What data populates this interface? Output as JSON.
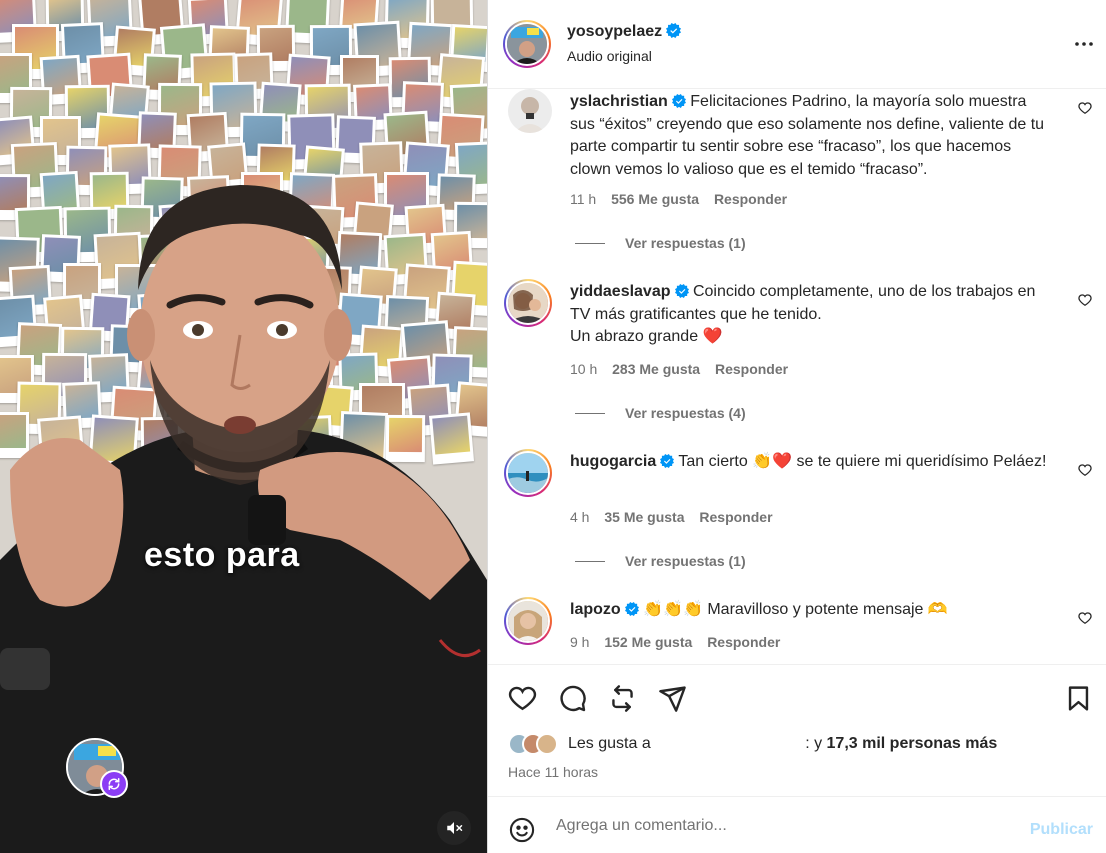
{
  "video": {
    "caption": "esto para",
    "mute_icon": "muted-speaker-icon",
    "remix_icon": "remix-icon"
  },
  "header": {
    "username": "yosoypelaez",
    "subtitle": "Audio original",
    "more_icon": "more-horizontal-icon"
  },
  "comments": [
    {
      "username": "yslachristian",
      "text": "Felicitaciones Padrino, la mayoría solo muestra sus “éxitos” creyendo que eso solamente nos define, valiente de tu parte compartir tu sentir sobre ese “fracaso”, los que hacemos clown vemos lo valioso que es el temido “fracaso”.",
      "time": "11 h",
      "likes": "556 Me gusta",
      "reply": "Responder",
      "view_replies": "Ver respuestas (1)"
    },
    {
      "username": "yiddaeslavap",
      "text": "Coincido completamente, uno de los trabajos en TV más gratificantes que he tenido.",
      "text2": "Un abrazo grande ❤️",
      "time": "10 h",
      "likes": "283 Me gusta",
      "reply": "Responder",
      "view_replies": "Ver respuestas (4)"
    },
    {
      "username": "hugogarcia",
      "text": "Tan cierto 👏❤️ se te quiere mi queridísimo Peláez!",
      "time": "4 h",
      "likes": "35 Me gusta",
      "reply": "Responder",
      "view_replies": "Ver respuestas (1)"
    },
    {
      "username": "lapozo",
      "text": "👏👏👏 Maravilloso y potente mensaje 🫶",
      "time": "9 h",
      "likes": "152 Me gusta",
      "reply": "Responder"
    }
  ],
  "actions": {
    "like_icon": "heart-icon",
    "comment_icon": "comment-bubble-icon",
    "repost_icon": "repost-icon",
    "share_icon": "paper-plane-icon",
    "save_icon": "bookmark-icon"
  },
  "likes": {
    "prefix": "Les gusta a",
    "suffix_pre": ": y ",
    "count": "17,3 mil personas más",
    "time_ago": "Hace 11 horas"
  },
  "add_comment": {
    "placeholder": "Agrega un comentario...",
    "publish": "Publicar",
    "emoji_icon": "smiley-icon"
  },
  "colors": {
    "verified": "#0095f6",
    "secondary_text": "#737373",
    "primary_text": "#262626",
    "publish_disabled": "#b2dffc",
    "heart_red": "#ed1c24",
    "remix_purple": "#8b3df5"
  }
}
